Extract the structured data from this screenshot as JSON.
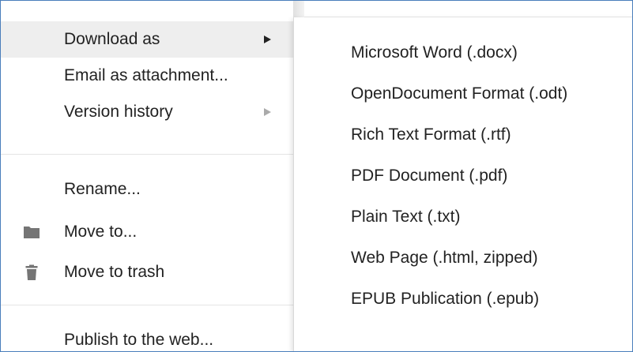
{
  "file_menu": {
    "items": [
      {
        "label": "Download as",
        "has_submenu": true,
        "submenu_arrow_color": "#222222",
        "active": true
      },
      {
        "label": "Email as attachment...",
        "has_submenu": false
      },
      {
        "label": "Version history",
        "has_submenu": true,
        "submenu_arrow_color": "#aaaaaa"
      },
      {
        "label": "Rename..."
      },
      {
        "label": "Move to...",
        "icon": "folder-icon"
      },
      {
        "label": "Move to trash",
        "icon": "trash-icon"
      },
      {
        "label": "Publish to the web..."
      }
    ]
  },
  "download_submenu": {
    "items": [
      {
        "label": "Microsoft Word (.docx)"
      },
      {
        "label": "OpenDocument Format (.odt)"
      },
      {
        "label": "Rich Text Format (.rtf)"
      },
      {
        "label": "PDF Document (.pdf)"
      },
      {
        "label": "Plain Text (.txt)"
      },
      {
        "label": "Web Page (.html, zipped)"
      },
      {
        "label": "EPUB Publication (.epub)"
      }
    ]
  },
  "colors": {
    "frame_border": "#4a7ebb",
    "active_item_background": "#eeeeee",
    "icon_gray": "#757575",
    "separator": "#e5e5e5"
  }
}
